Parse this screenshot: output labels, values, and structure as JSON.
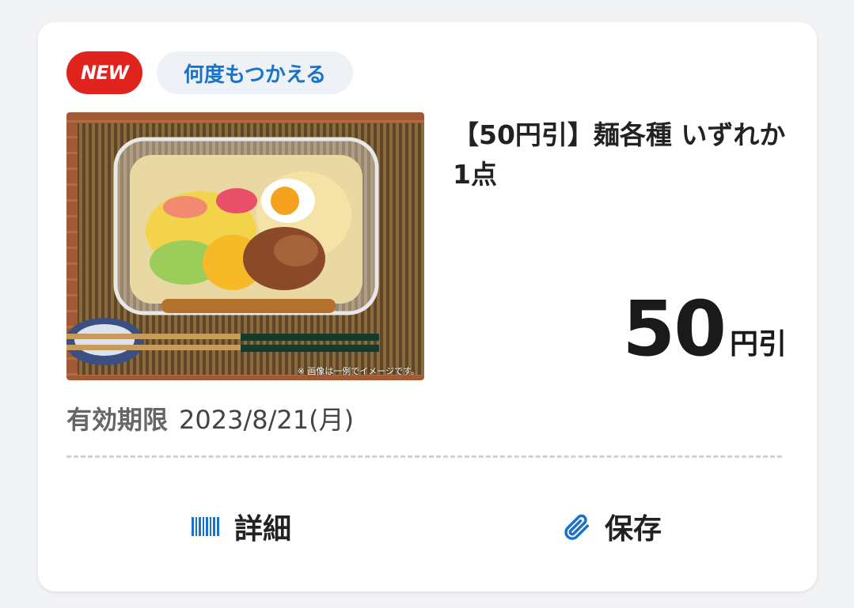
{
  "badges": {
    "new": "NEW",
    "reuse": "何度もつかえる"
  },
  "product": {
    "image_note": "※ 画像は一例でイメージです。",
    "title": "【50円引】麺各種 いずれか1点"
  },
  "price": {
    "amount": "50",
    "unit": "円引"
  },
  "expiry": {
    "label": "有効期限",
    "date": "2023/8/21(月)"
  },
  "actions": {
    "detail_label": "詳細",
    "save_label": "保存"
  },
  "colors": {
    "new_badge": "#e0231c",
    "accent_blue": "#1a73c9",
    "reuse_badge_bg": "#eef2f6"
  },
  "icons": {
    "detail": "barcode-icon",
    "save": "paperclip-icon"
  }
}
